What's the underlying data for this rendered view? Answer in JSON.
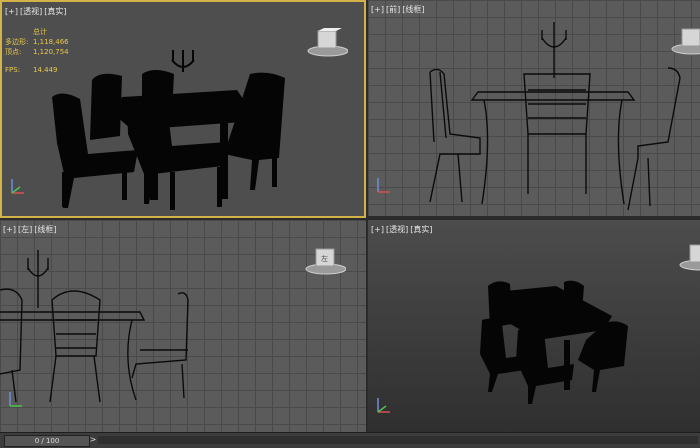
{
  "viewports": {
    "top_left": {
      "label": [
        "[+]",
        "[透视]",
        "[真实]"
      ]
    },
    "top_right": {
      "label": [
        "[+]",
        "[前]",
        "[线框]"
      ]
    },
    "bottom_left": {
      "label": [
        "[+]",
        "[左]",
        "[线框]"
      ]
    },
    "bottom_right": {
      "label": [
        "[+]",
        "[透视]",
        "[真实]"
      ]
    }
  },
  "stats": {
    "total_label": "总计",
    "polys_label": "多边形:",
    "polys_value": "1,118,466",
    "verts_label": "顶点:",
    "verts_value": "1,120,754",
    "fps_label": "FPS:",
    "fps_value": "14.449"
  },
  "viewcube_left_label": "左",
  "timeline": {
    "frame_display": "0 / 100",
    "next_arrow": ">"
  },
  "colors": {
    "active_border": "#d4b24a",
    "stats_text": "#e8c84a"
  },
  "icons": [
    "viewcube-icon",
    "axis-tripod-icon",
    "candelabra-icon"
  ]
}
